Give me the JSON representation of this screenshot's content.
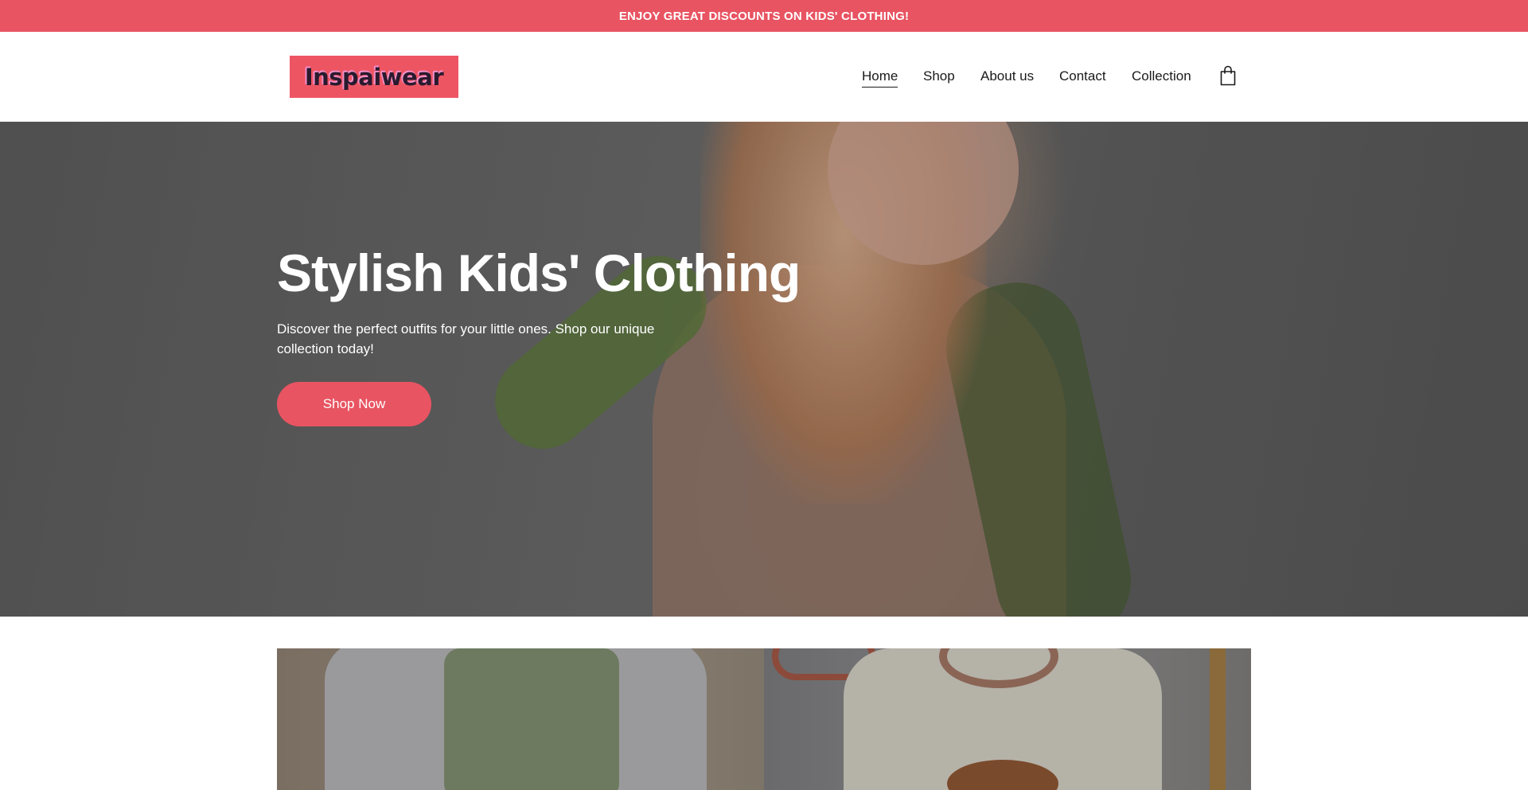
{
  "announcement": {
    "text": "ENJOY GREAT DISCOUNTS ON KIDS' CLOTHING!"
  },
  "brand": {
    "logo_text": "Inspaiwear",
    "accent": "#e85462"
  },
  "nav": {
    "items": [
      {
        "label": "Home",
        "active": true
      },
      {
        "label": "Shop",
        "active": false
      },
      {
        "label": "About us",
        "active": false
      },
      {
        "label": "Contact",
        "active": false
      },
      {
        "label": "Collection",
        "active": false
      }
    ],
    "cart_icon": "shopping-bag-icon"
  },
  "hero": {
    "title": "Stylish Kids' Clothing",
    "subtitle": "Discover the perfect outfits for your little ones. Shop our unique collection today!",
    "cta_label": "Shop Now",
    "image_alt": "girl in green-sleeved sweater"
  }
}
